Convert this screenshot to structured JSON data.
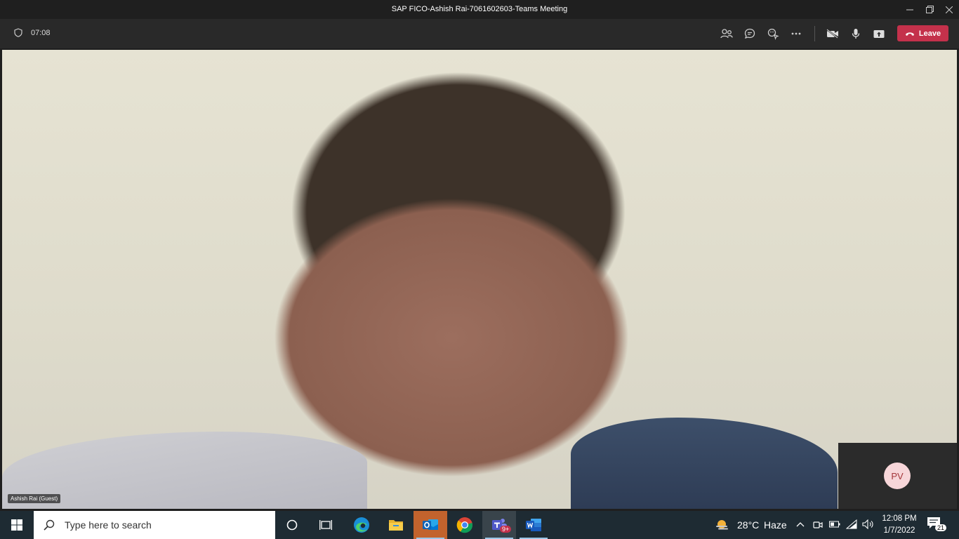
{
  "window": {
    "title": "SAP FICO-Ashish Rai-7061602603-Teams Meeting"
  },
  "toolbar": {
    "timer": "07:08",
    "leave_label": "Leave",
    "icons": [
      "shield-icon",
      "participants-icon",
      "chat-icon",
      "reactions-icon",
      "more-options-icon",
      "camera-off-icon",
      "microphone-icon",
      "share-screen-icon",
      "phone-hangup-icon"
    ]
  },
  "stage": {
    "participant_name": "Ashish Rai (Guest)",
    "self_initials": "PV"
  },
  "taskbar": {
    "search_placeholder": "Type here to search",
    "weather_temp": "28°C",
    "weather_desc": "Haze",
    "time": "12:08 PM",
    "date": "1/7/2022",
    "notifications_count": "21",
    "teams_badge": "9+",
    "apps": [
      "cortana-icon",
      "task-view-icon",
      "edge-icon",
      "file-explorer-icon",
      "outlook-icon",
      "chrome-icon",
      "teams-icon",
      "word-icon"
    ]
  },
  "colors": {
    "leave_red": "#c4314b",
    "taskbar_bg": "#1e2b33",
    "avatar_bg": "#f7d6d9"
  }
}
